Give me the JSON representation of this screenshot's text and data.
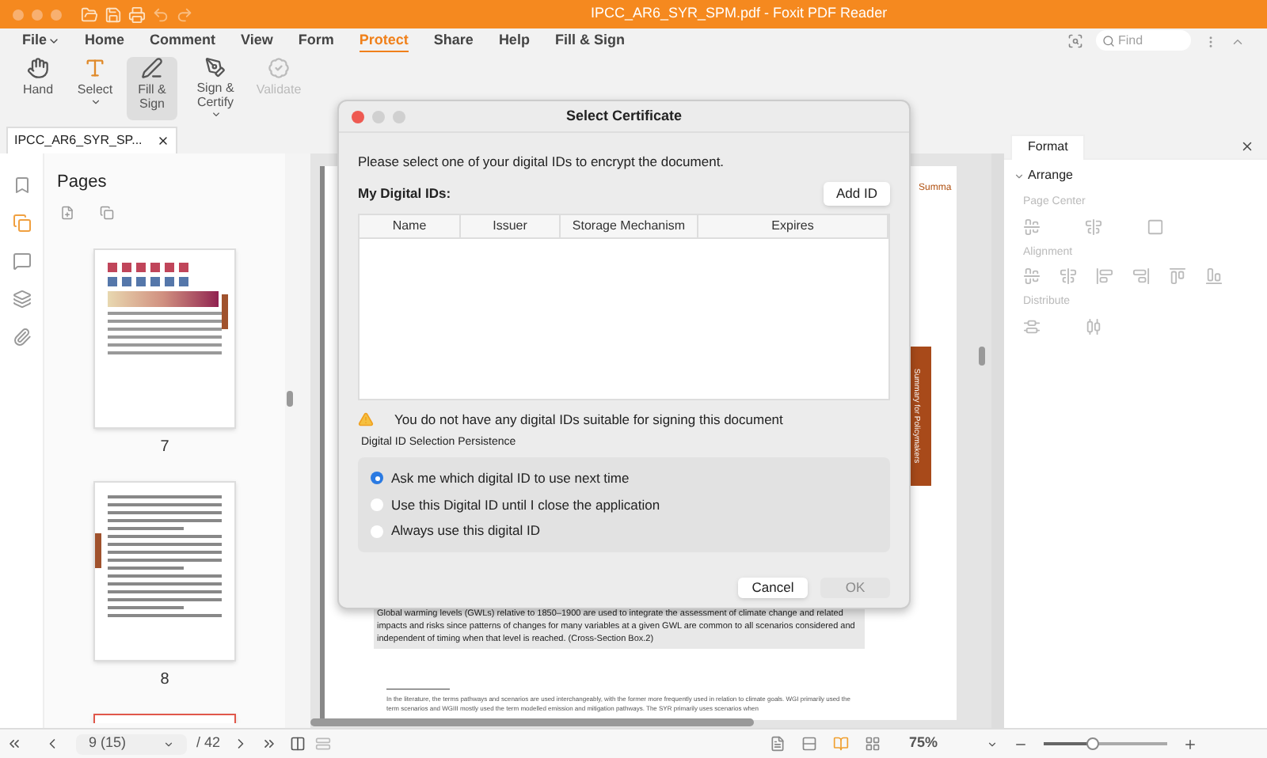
{
  "window": {
    "title": "IPCC_AR6_SYR_SPM.pdf - Foxit PDF Reader"
  },
  "menu": [
    {
      "label": "File",
      "dropdown": true,
      "selected": false
    },
    {
      "label": "Home",
      "dropdown": false,
      "selected": false
    },
    {
      "label": "Comment",
      "dropdown": false,
      "selected": false
    },
    {
      "label": "View",
      "dropdown": false,
      "selected": false
    },
    {
      "label": "Form",
      "dropdown": false,
      "selected": false
    },
    {
      "label": "Protect",
      "dropdown": false,
      "selected": true
    },
    {
      "label": "Share",
      "dropdown": false,
      "selected": false
    },
    {
      "label": "Help",
      "dropdown": false,
      "selected": false
    },
    {
      "label": "Fill & Sign",
      "dropdown": false,
      "selected": false
    }
  ],
  "search": {
    "placeholder": "Find"
  },
  "ribbon": [
    {
      "kind": "hand",
      "label": "Hand",
      "selected": false,
      "disabled": false,
      "dropdown": false
    },
    {
      "kind": "select",
      "label": "Select",
      "selected": false,
      "disabled": false,
      "dropdown": true
    },
    {
      "kind": "fill",
      "label": "Fill & Sign",
      "selected": true,
      "disabled": false,
      "dropdown": false
    },
    {
      "kind": "sign",
      "label": "Sign & Certify",
      "selected": false,
      "disabled": false,
      "dropdown": true
    },
    {
      "kind": "validate",
      "label": "Validate",
      "selected": false,
      "disabled": true,
      "dropdown": false
    }
  ],
  "doc_tab": {
    "title": "IPCC_AR6_SYR_SP..."
  },
  "side_tools": [
    {
      "kind": "bookmark",
      "selected": false
    },
    {
      "kind": "pages",
      "selected": true
    },
    {
      "kind": "comments",
      "selected": false
    },
    {
      "kind": "layers",
      "selected": false
    },
    {
      "kind": "attachment",
      "selected": false
    }
  ],
  "pages_panel": {
    "title": "Pages",
    "thumbnails": [
      {
        "kind": "chart",
        "label": "7",
        "selected": false
      },
      {
        "kind": "text",
        "label": "8",
        "selected": false
      },
      {
        "kind": "text",
        "selected": true
      }
    ]
  },
  "document": {
    "running_head": "Summa",
    "side_tab": "Summary for Policymakers",
    "paragraph": "Global warming levels (GWLs) relative to 1850–1900 are used to integrate the assessment of climate change and related impacts and risks since patterns of changes for many variables at a given GWL are common to all scenarios considered and independent of timing when that level is reached. (Cross-Section Box.2)",
    "footnote": "In the literature, the terms pathways and scenarios are used interchangeably, with the former more frequently used in relation to climate goals. WGI primarily used the term scenarios and WGIII mostly used the term modelled emission and mitigation pathways. The SYR primarily uses scenarios when"
  },
  "dialog": {
    "title": "Select Certificate",
    "prompt": "Please select one of your digital IDs to encrypt the document.",
    "list_label": "My Digital IDs:",
    "add_button": "Add ID",
    "columns": [
      "Name",
      "Issuer",
      "Storage Mechanism",
      "Expires"
    ],
    "warning": "You do not have any digital IDs suitable for signing this document",
    "persistence_label": "Digital ID Selection Persistence",
    "options": [
      {
        "label": "Ask me which digital ID to use next time",
        "selected": true
      },
      {
        "label": "Use this Digital ID until I close the application",
        "selected": false
      },
      {
        "label": "Always use this digital ID",
        "selected": false
      }
    ],
    "buttons": [
      {
        "label": "Cancel",
        "disabled": false
      },
      {
        "label": "OK",
        "disabled": true
      }
    ]
  },
  "format_panel": {
    "tab": "Format",
    "section": "Arrange",
    "expanded": true,
    "groups": [
      {
        "title": "Page Center",
        "kind": "center"
      },
      {
        "title": "Alignment",
        "kind": "align"
      },
      {
        "title": "Distribute",
        "kind": "distribute"
      }
    ]
  },
  "status": {
    "page": "9 (15)",
    "total": "/ 42",
    "zoom": "75%",
    "views": [
      {
        "selected": false
      },
      {
        "selected": false
      },
      {
        "selected": true
      },
      {
        "selected": false
      }
    ],
    "zoom_slider": {
      "level": 0.4
    }
  }
}
